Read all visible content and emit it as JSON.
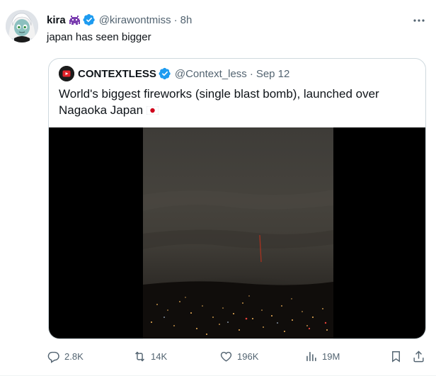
{
  "tweet": {
    "author_name": "kira",
    "author_handle": "@kirawontmiss",
    "separator": "·",
    "time": "8h",
    "text": "japan has seen bigger"
  },
  "quote": {
    "author_name": "CONTEXTLESS",
    "author_handle": "@Context_less",
    "separator": "·",
    "date": "Sep 12",
    "text": "World's biggest fireworks (single blast bomb), launched over Nagaoka Japan"
  },
  "actions": {
    "replies": "2.8K",
    "retweets": "14K",
    "likes": "196K",
    "views": "19M"
  },
  "icons": [
    "more-icon",
    "verified-badge-icon",
    "reply-icon",
    "retweet-icon",
    "like-icon",
    "views-icon",
    "bookmark-icon",
    "share-icon",
    "japan-flag-icon"
  ],
  "colors": {
    "text_primary": "#0f1419",
    "text_secondary": "#536471",
    "verified_blue": "#1d9bf0",
    "border": "#cfd9de",
    "media_bg": "#000000"
  }
}
